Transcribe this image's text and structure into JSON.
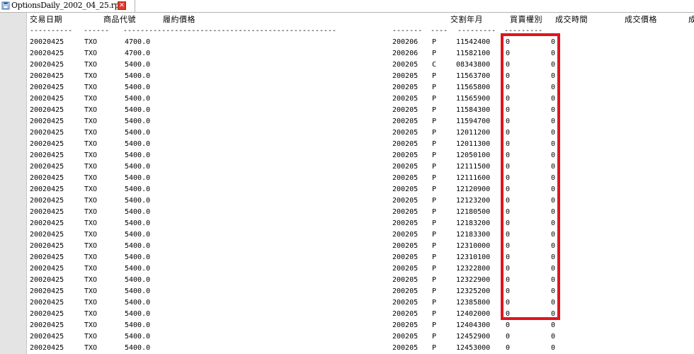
{
  "tab": {
    "title": "OptionsDaily_2002_04_25.rpt",
    "close_label": "✕"
  },
  "header": {
    "trade_date": "交易日期",
    "product_code": "商品代號",
    "strike_price": "履約價格",
    "delivery_month": "交割年月",
    "call_put": "買賣權別",
    "trade_time": "成交時間",
    "trade_price": "成交價格",
    "trailing": "成"
  },
  "separator": {
    "d1": "----------",
    "d2": "------",
    "d3": "--------------------------------------------------",
    "d4": "-------",
    "d5": "----",
    "d6": "---------",
    "d7": "---------"
  },
  "line_numbers": [
    "1",
    "2",
    "3",
    "4",
    "5",
    "6",
    "7",
    "8",
    "9",
    "10",
    "11",
    "12",
    "13",
    "14",
    "15",
    "16",
    "17",
    "18",
    "19",
    "20",
    "21",
    "22",
    "23",
    "24",
    "25",
    "26",
    "27",
    "28",
    "29",
    "30"
  ],
  "rows": [
    {
      "date": "20020425",
      "code": "TXO",
      "strike": "4700.0",
      "month": "200206",
      "cp": "P",
      "time": "11542400",
      "a": "0",
      "b": "0"
    },
    {
      "date": "20020425",
      "code": "TXO",
      "strike": "4700.0",
      "month": "200206",
      "cp": "P",
      "time": "11582100",
      "a": "0",
      "b": "0"
    },
    {
      "date": "20020425",
      "code": "TXO",
      "strike": "5400.0",
      "month": "200205",
      "cp": "C",
      "time": "08343800",
      "a": "0",
      "b": "0"
    },
    {
      "date": "20020425",
      "code": "TXO",
      "strike": "5400.0",
      "month": "200205",
      "cp": "P",
      "time": "11563700",
      "a": "0",
      "b": "0"
    },
    {
      "date": "20020425",
      "code": "TXO",
      "strike": "5400.0",
      "month": "200205",
      "cp": "P",
      "time": "11565800",
      "a": "0",
      "b": "0"
    },
    {
      "date": "20020425",
      "code": "TXO",
      "strike": "5400.0",
      "month": "200205",
      "cp": "P",
      "time": "11565900",
      "a": "0",
      "b": "0"
    },
    {
      "date": "20020425",
      "code": "TXO",
      "strike": "5400.0",
      "month": "200205",
      "cp": "P",
      "time": "11584300",
      "a": "0",
      "b": "0"
    },
    {
      "date": "20020425",
      "code": "TXO",
      "strike": "5400.0",
      "month": "200205",
      "cp": "P",
      "time": "11594700",
      "a": "0",
      "b": "0"
    },
    {
      "date": "20020425",
      "code": "TXO",
      "strike": "5400.0",
      "month": "200205",
      "cp": "P",
      "time": "12011200",
      "a": "0",
      "b": "0"
    },
    {
      "date": "20020425",
      "code": "TXO",
      "strike": "5400.0",
      "month": "200205",
      "cp": "P",
      "time": "12011300",
      "a": "0",
      "b": "0"
    },
    {
      "date": "20020425",
      "code": "TXO",
      "strike": "5400.0",
      "month": "200205",
      "cp": "P",
      "time": "12050100",
      "a": "0",
      "b": "0"
    },
    {
      "date": "20020425",
      "code": "TXO",
      "strike": "5400.0",
      "month": "200205",
      "cp": "P",
      "time": "12111500",
      "a": "0",
      "b": "0"
    },
    {
      "date": "20020425",
      "code": "TXO",
      "strike": "5400.0",
      "month": "200205",
      "cp": "P",
      "time": "12111600",
      "a": "0",
      "b": "0"
    },
    {
      "date": "20020425",
      "code": "TXO",
      "strike": "5400.0",
      "month": "200205",
      "cp": "P",
      "time": "12120900",
      "a": "0",
      "b": "0"
    },
    {
      "date": "20020425",
      "code": "TXO",
      "strike": "5400.0",
      "month": "200205",
      "cp": "P",
      "time": "12123200",
      "a": "0",
      "b": "0"
    },
    {
      "date": "20020425",
      "code": "TXO",
      "strike": "5400.0",
      "month": "200205",
      "cp": "P",
      "time": "12180500",
      "a": "0",
      "b": "0"
    },
    {
      "date": "20020425",
      "code": "TXO",
      "strike": "5400.0",
      "month": "200205",
      "cp": "P",
      "time": "12183200",
      "a": "0",
      "b": "0"
    },
    {
      "date": "20020425",
      "code": "TXO",
      "strike": "5400.0",
      "month": "200205",
      "cp": "P",
      "time": "12183300",
      "a": "0",
      "b": "0"
    },
    {
      "date": "20020425",
      "code": "TXO",
      "strike": "5400.0",
      "month": "200205",
      "cp": "P",
      "time": "12310000",
      "a": "0",
      "b": "0"
    },
    {
      "date": "20020425",
      "code": "TXO",
      "strike": "5400.0",
      "month": "200205",
      "cp": "P",
      "time": "12310100",
      "a": "0",
      "b": "0"
    },
    {
      "date": "20020425",
      "code": "TXO",
      "strike": "5400.0",
      "month": "200205",
      "cp": "P",
      "time": "12322800",
      "a": "0",
      "b": "0"
    },
    {
      "date": "20020425",
      "code": "TXO",
      "strike": "5400.0",
      "month": "200205",
      "cp": "P",
      "time": "12322900",
      "a": "0",
      "b": "0"
    },
    {
      "date": "20020425",
      "code": "TXO",
      "strike": "5400.0",
      "month": "200205",
      "cp": "P",
      "time": "12325200",
      "a": "0",
      "b": "0"
    },
    {
      "date": "20020425",
      "code": "TXO",
      "strike": "5400.0",
      "month": "200205",
      "cp": "P",
      "time": "12385800",
      "a": "0",
      "b": "0"
    },
    {
      "date": "20020425",
      "code": "TXO",
      "strike": "5400.0",
      "month": "200205",
      "cp": "P",
      "time": "12402000",
      "a": "0",
      "b": "0"
    },
    {
      "date": "20020425",
      "code": "TXO",
      "strike": "5400.0",
      "month": "200205",
      "cp": "P",
      "time": "12404300",
      "a": "0",
      "b": "0"
    },
    {
      "date": "20020425",
      "code": "TXO",
      "strike": "5400.0",
      "month": "200205",
      "cp": "P",
      "time": "12452900",
      "a": "0",
      "b": "0"
    },
    {
      "date": "20020425",
      "code": "TXO",
      "strike": "5400.0",
      "month": "200205",
      "cp": "P",
      "time": "12453000",
      "a": "0",
      "b": "0"
    }
  ],
  "colors": {
    "highlight": "#e0141e",
    "gutter": "#e4e4e4",
    "line_number": "#808080"
  }
}
